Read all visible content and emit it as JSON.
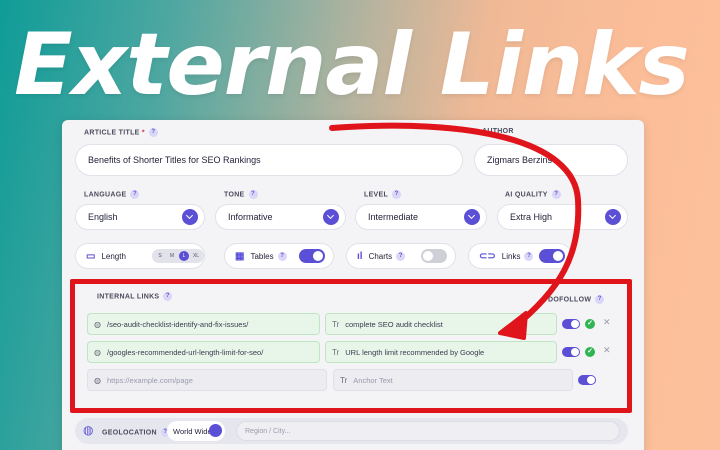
{
  "hero": {
    "title": "External Links"
  },
  "form": {
    "article_title": {
      "label": "ARTICLE TITLE",
      "required_mark": "*",
      "value": "Benefits of Shorter Titles for SEO Rankings"
    },
    "author": {
      "label": "AUTHOR",
      "value": "Zigmars Berzins"
    },
    "language": {
      "label": "LANGUAGE",
      "value": "English"
    },
    "tone": {
      "label": "TONE",
      "value": "Informative"
    },
    "level": {
      "label": "LEVEL",
      "value": "Intermediate"
    },
    "ai_quality": {
      "label": "AI QUALITY",
      "value": "Extra High"
    },
    "help_glyph": "?"
  },
  "options": {
    "length": {
      "label": "Length",
      "sizes": [
        "S",
        "M",
        "L",
        "XL"
      ],
      "selected": "L"
    },
    "tables": {
      "label": "Tables",
      "enabled": true
    },
    "charts": {
      "label": "Charts",
      "enabled": false
    },
    "links": {
      "label": "Links",
      "enabled": true
    }
  },
  "internal_links": {
    "label": "INTERNAL LINKS",
    "dofollow_label": "DOFOLLOW",
    "rows": [
      {
        "url": "/seo-audit-checklist-identify-and-fix-issues/",
        "anchor": "complete SEO audit checklist",
        "dofollow": true,
        "verified": true
      },
      {
        "url": "/googles-recommended-url-length-limit-for-seo/",
        "anchor": "URL length limit recommended by Google",
        "dofollow": true,
        "verified": true
      }
    ],
    "new_row": {
      "url_placeholder": "https://example.com/page",
      "anchor_placeholder": "Anchor Text"
    }
  },
  "geolocation": {
    "label": "GEOLOCATION",
    "value": "World Wide",
    "placeholder": "Region / City..."
  },
  "colors": {
    "accent": "#5b4fd6",
    "highlight": "#e0151c",
    "success": "#2fb553"
  },
  "icons": {
    "globe": "globe-icon",
    "text": "text-format-icon",
    "link": "link-icon",
    "table": "table-icon",
    "chart": "bar-chart-icon",
    "length": "ruler-icon",
    "close": "close-icon",
    "check": "check-icon"
  }
}
